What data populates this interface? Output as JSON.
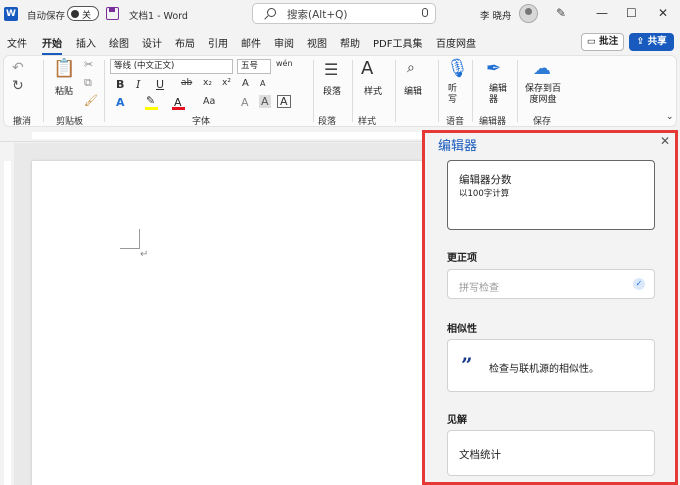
{
  "titlebar": {
    "app_logo": "W",
    "autosave_label": "自动保存",
    "autosave_state": "关",
    "doc_title": "文档1  -  Word",
    "search_placeholder": "搜索(Alt+Q)",
    "user_name": "李 晓舟",
    "minimize": "—",
    "maximize": "☐",
    "close": "✕"
  },
  "tabs": [
    "文件",
    "开始",
    "插入",
    "绘图",
    "设计",
    "布局",
    "引用",
    "邮件",
    "审阅",
    "视图",
    "帮助",
    "PDF工具集",
    "百度网盘"
  ],
  "active_tab": "开始",
  "comment_button": "批注",
  "share_button": "共享",
  "ribbon": {
    "undo_group": "撤消",
    "clipboard": {
      "paste": "粘贴",
      "label": "剪贴板"
    },
    "font": {
      "name": "等线 (中文正文)",
      "size": "五号",
      "label": "字体",
      "bold": "B",
      "italic": "I",
      "underline": "U",
      "strike": "ab",
      "sub": "x₂",
      "sup": "x²",
      "grow": "A",
      "shrink": "A",
      "aa": "Aa",
      "clear": "A",
      "charborder": "A",
      "highlight_color": "#ffff00",
      "font_color": "#e81123"
    },
    "paragraph": {
      "label": "段落"
    },
    "styles": {
      "label": "样式"
    },
    "editing": {
      "label": "编辑"
    },
    "dictate": {
      "label": "听写",
      "group": "语音"
    },
    "editor": {
      "label": "编辑器",
      "group": "编辑器"
    },
    "save_baidu": {
      "label": "保存到百度网盘",
      "group": "保存"
    }
  },
  "document": {
    "para_mark": "↵"
  },
  "editor_pane": {
    "title": "编辑器",
    "score_title": "编辑器分数",
    "score_sub": "以100字计算",
    "corrections_heading": "更正项",
    "spellcheck": "拼写检查",
    "similarity_heading": "相似性",
    "similarity_text": "检查与联机源的相似性。",
    "insights_heading": "见解",
    "doc_stats": "文档统计"
  }
}
